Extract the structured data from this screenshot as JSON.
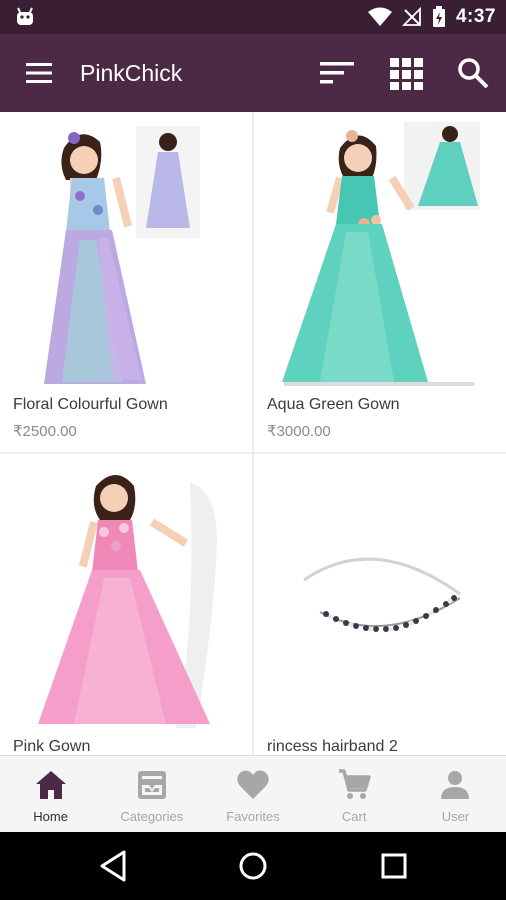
{
  "status_bar": {
    "time": "4:37"
  },
  "app_bar": {
    "title": "PinkChick"
  },
  "products": [
    {
      "name": "Floral Colourful Gown",
      "price": "₹2500.00"
    },
    {
      "name": "Aqua Green Gown",
      "price": "₹3000.00"
    },
    {
      "name": "Pink Gown",
      "price": ""
    },
    {
      "name": "rincess hairband 2",
      "price": ""
    }
  ],
  "bottom_nav": [
    {
      "label": "Home",
      "icon": "home-icon",
      "active": true
    },
    {
      "label": "Categories",
      "icon": "categories-icon",
      "active": false
    },
    {
      "label": "Favorites",
      "icon": "heart-icon",
      "active": false
    },
    {
      "label": "Cart",
      "icon": "cart-icon",
      "active": false
    },
    {
      "label": "User",
      "icon": "user-icon",
      "active": false
    }
  ],
  "colors": {
    "status_bar": "#3a1f34",
    "app_bar": "#4c2a45",
    "active_tab": "#4c2a45",
    "inactive_tab": "#a7a7a7"
  }
}
